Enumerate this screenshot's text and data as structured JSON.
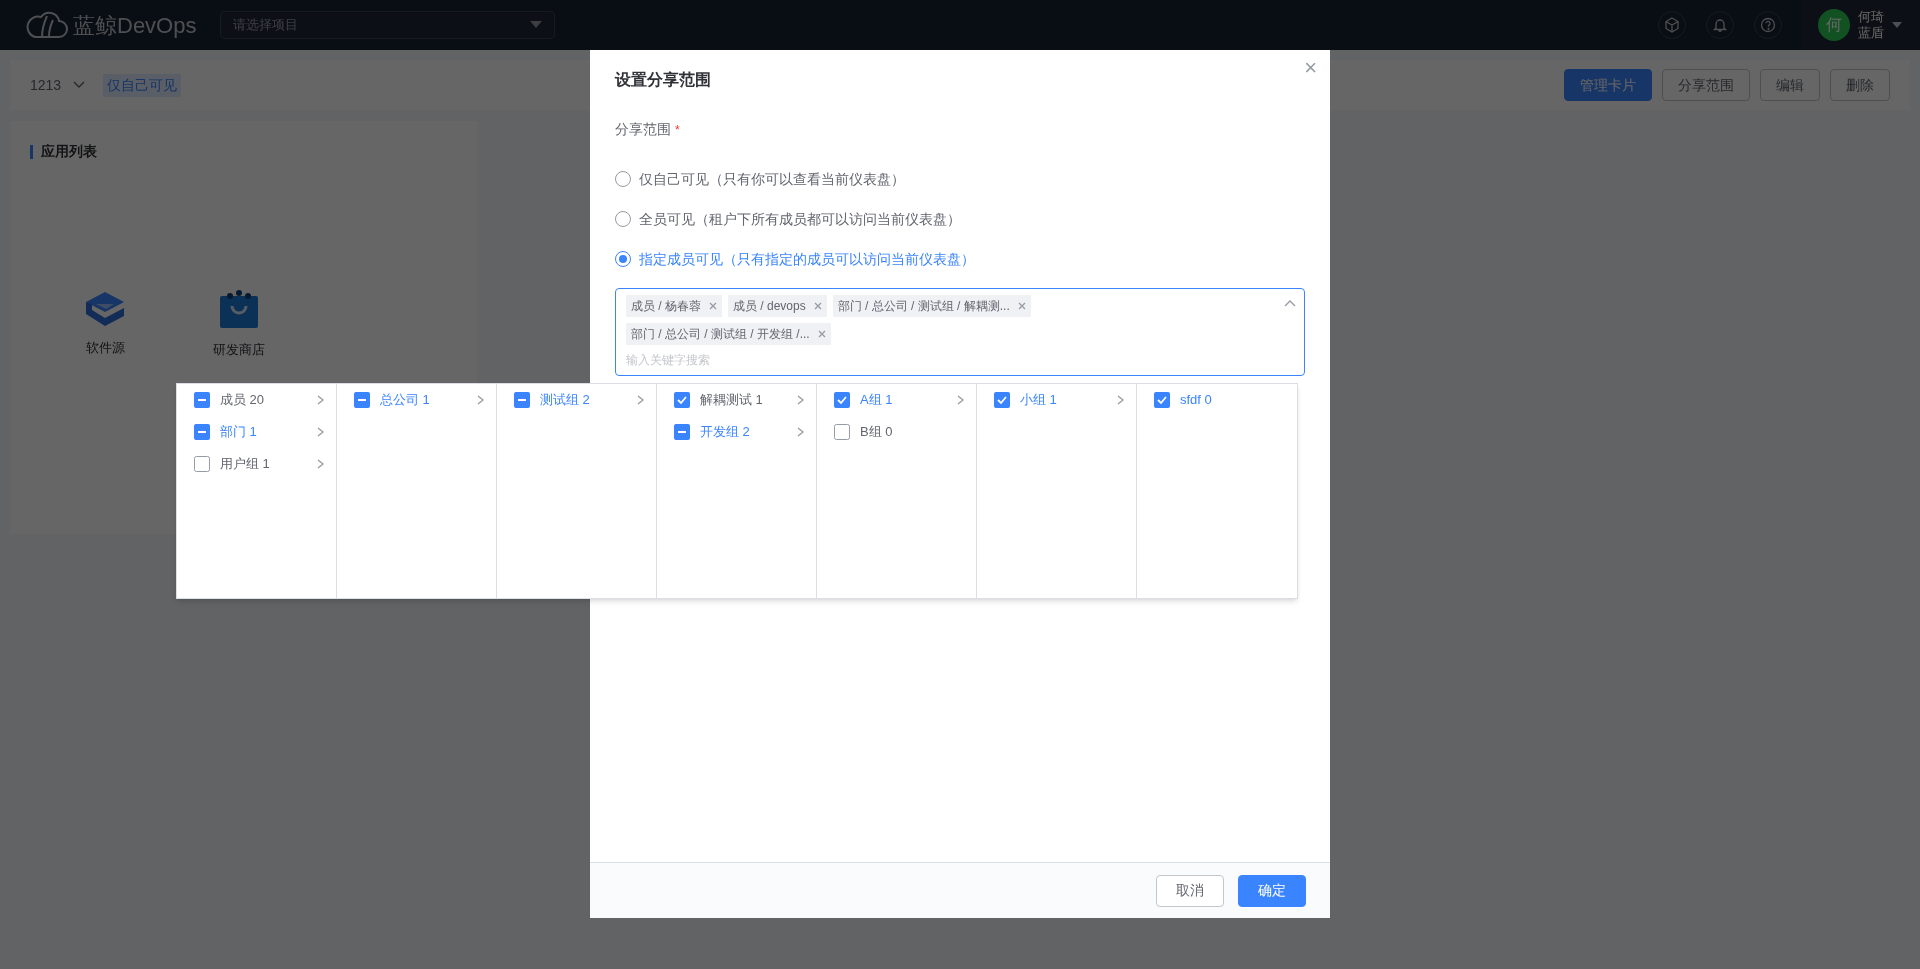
{
  "header": {
    "logo_text": "蓝鲸DevOps",
    "project_select": {
      "placeholder": "请选择项目"
    },
    "user": {
      "avatar": "何",
      "name": "何琦",
      "org": "蓝盾"
    }
  },
  "toolbar": {
    "dashboard": "1213",
    "visibility_tag": "仅自己可见",
    "buttons": [
      {
        "label": "管理卡片",
        "kind": "primary"
      },
      {
        "label": "分享范围",
        "kind": "default"
      },
      {
        "label": "编辑",
        "kind": "default"
      },
      {
        "label": "删除",
        "kind": "default"
      }
    ]
  },
  "app_panel": {
    "title": "应用列表",
    "apps": [
      {
        "label": "软件源",
        "kind": "source"
      },
      {
        "label": "研发商店",
        "kind": "store"
      }
    ]
  },
  "dialog": {
    "title": "设置分享范围",
    "close": "×",
    "field_label": "分享范围",
    "required_mark": "*",
    "options": [
      {
        "label": "仅自己可见（只有你可以查看当前仪表盘）",
        "selected": false
      },
      {
        "label": "全员可见（租户下所有成员都可以访问当前仪表盘）",
        "selected": false
      },
      {
        "label": "指定成员可见（只有指定的成员可以访问当前仪表盘）",
        "selected": true
      }
    ],
    "tags": [
      "成员 / 杨春蓉",
      "成员 / devops",
      "部门 / 总公司 / 测试组 / 解耦测...",
      "部门 / 总公司 / 测试组 / 开发组 /..."
    ],
    "search": {
      "placeholder": "输入关键字搜索"
    },
    "footer_buttons": [
      {
        "label": "取消",
        "kind": "default"
      },
      {
        "label": "确定",
        "kind": "primary"
      }
    ]
  },
  "cascader": {
    "columns": [
      {
        "items": [
          {
            "label": "成员 20",
            "checked": false,
            "indeterminate": true,
            "selected": false,
            "expandable": true
          },
          {
            "label": "部门 1",
            "checked": false,
            "indeterminate": true,
            "selected": true,
            "expandable": true
          },
          {
            "label": "用户组 1",
            "checked": false,
            "indeterminate": false,
            "selected": false,
            "expandable": true
          }
        ]
      },
      {
        "items": [
          {
            "label": "总公司 1",
            "checked": false,
            "indeterminate": true,
            "selected": true,
            "expandable": true
          }
        ]
      },
      {
        "items": [
          {
            "label": "测试组 2",
            "checked": false,
            "indeterminate": true,
            "selected": true,
            "expandable": true
          }
        ]
      },
      {
        "items": [
          {
            "label": "解耦测试 1",
            "checked": true,
            "indeterminate": false,
            "selected": false,
            "expandable": true
          },
          {
            "label": "开发组 2",
            "checked": false,
            "indeterminate": true,
            "selected": true,
            "expandable": true
          }
        ]
      },
      {
        "items": [
          {
            "label": "A组 1",
            "checked": true,
            "indeterminate": false,
            "selected": true,
            "expandable": true
          },
          {
            "label": "B组 0",
            "checked": false,
            "indeterminate": false,
            "selected": false,
            "expandable": false
          }
        ]
      },
      {
        "items": [
          {
            "label": "小组 1",
            "checked": true,
            "indeterminate": false,
            "selected": true,
            "expandable": true
          }
        ]
      },
      {
        "items": [
          {
            "label": "sfdf 0",
            "checked": true,
            "indeterminate": false,
            "selected": true,
            "expandable": false
          }
        ]
      }
    ]
  }
}
